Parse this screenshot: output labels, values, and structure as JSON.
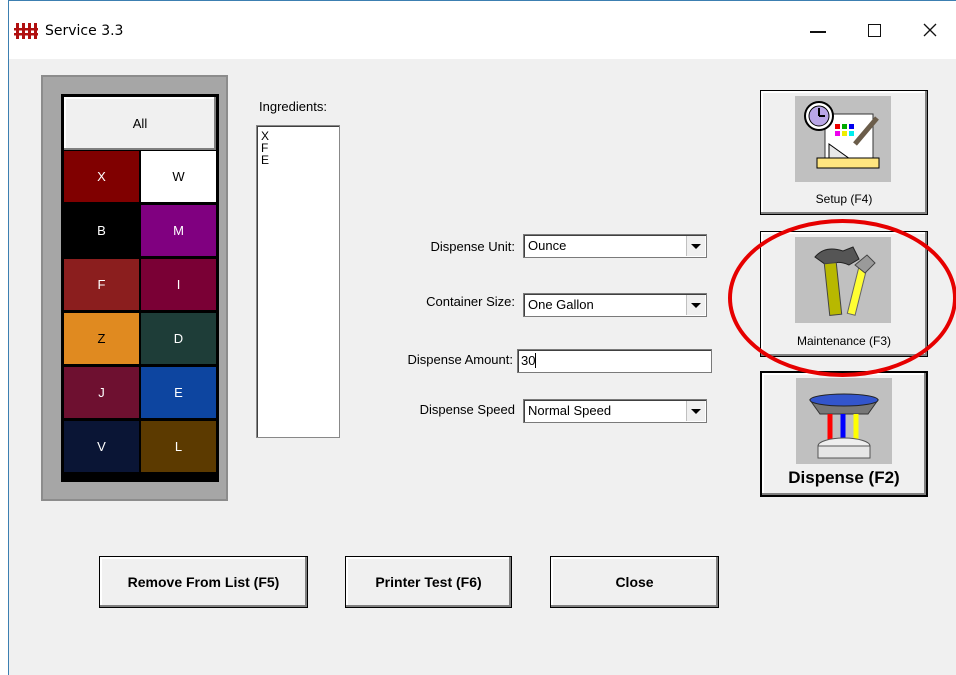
{
  "window": {
    "title": "Service 3.3"
  },
  "palette": {
    "all_label": "All",
    "swatches": [
      {
        "label": "X",
        "bg": "#800000",
        "fg": "#ffffff"
      },
      {
        "label": "W",
        "bg": "#ffffff",
        "fg": "#000000"
      },
      {
        "label": "B",
        "bg": "#000000",
        "fg": "#ffffff"
      },
      {
        "label": "M",
        "bg": "#800080",
        "fg": "#ffffff"
      },
      {
        "label": "F",
        "bg": "#8b1e1e",
        "fg": "#ffffff"
      },
      {
        "label": "I",
        "bg": "#7a0035",
        "fg": "#ffffff"
      },
      {
        "label": "Z",
        "bg": "#e08a20",
        "fg": "#000000"
      },
      {
        "label": "D",
        "bg": "#1e3d38",
        "fg": "#ffffff"
      },
      {
        "label": "J",
        "bg": "#6e1030",
        "fg": "#ffffff"
      },
      {
        "label": "E",
        "bg": "#0d45a0",
        "fg": "#ffffff"
      },
      {
        "label": "V",
        "bg": "#0a1535",
        "fg": "#ffffff"
      },
      {
        "label": "L",
        "bg": "#5c3a00",
        "fg": "#ffffff"
      }
    ]
  },
  "ingredients": {
    "label": "Ingredients:",
    "items": [
      "X",
      "F",
      "E"
    ]
  },
  "form": {
    "dispense_unit_label": "Dispense Unit:",
    "dispense_unit_value": "Ounce",
    "container_size_label": "Container Size:",
    "container_size_value": "One Gallon",
    "dispense_amount_label": "Dispense Amount:",
    "dispense_amount_value": "30",
    "dispense_speed_label": "Dispense Speed",
    "dispense_speed_value": "Normal Speed"
  },
  "side_buttons": {
    "setup_label": "Setup (F4)",
    "maintenance_label": "Maintenance (F3)",
    "dispense_label": "Dispense (F2)"
  },
  "bottom_buttons": {
    "remove_label": "Remove From List (F5)",
    "printer_label": "Printer Test (F6)",
    "close_label": "Close"
  },
  "icons": [
    "app-icon",
    "minimize-icon",
    "maximize-icon",
    "close-icon",
    "setup-icon",
    "maintenance-icon",
    "dispense-icon",
    "dropdown-arrow-icon"
  ],
  "colors": {
    "highlight_ring": "#e60000"
  }
}
